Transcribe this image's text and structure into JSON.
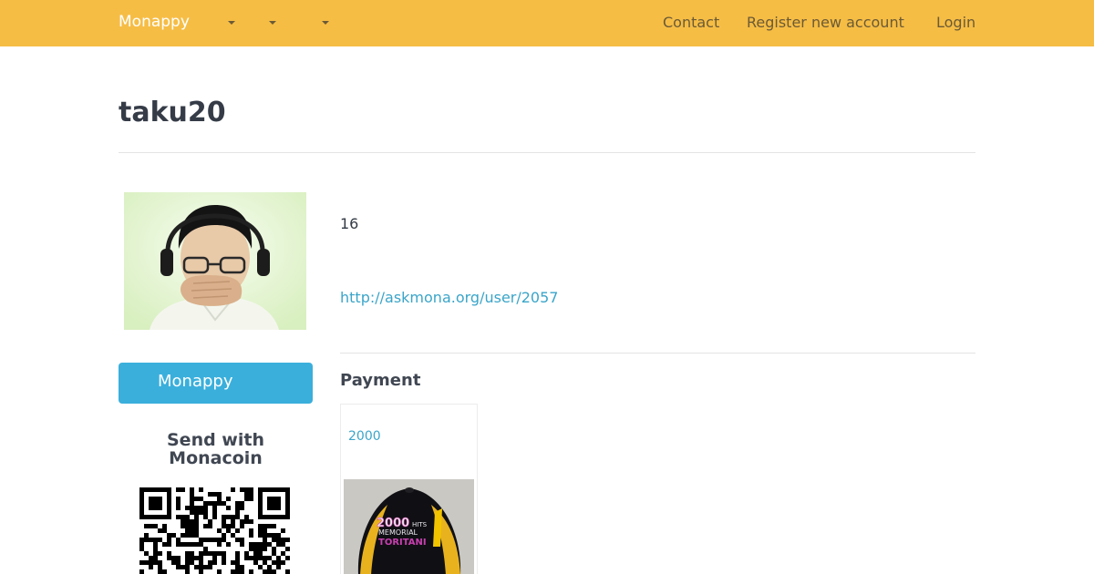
{
  "navbar": {
    "brand": "Monappy",
    "links": {
      "contact": "Contact",
      "register": "Register new account",
      "login": "Login"
    }
  },
  "user": {
    "name": "taku20",
    "count": "16",
    "url": "http://askmona.org/user/2057"
  },
  "sidebar": {
    "monappy_button": "Monappy",
    "send_heading": "Send with Monacoin"
  },
  "payment": {
    "heading": "Payment",
    "items": [
      {
        "price": "2000",
        "image_icon": "cap-photo"
      }
    ]
  },
  "colors": {
    "navbar": "#f6bd45",
    "button": "#3aafdc",
    "link": "#3aa5c9",
    "text": "#333a44"
  }
}
